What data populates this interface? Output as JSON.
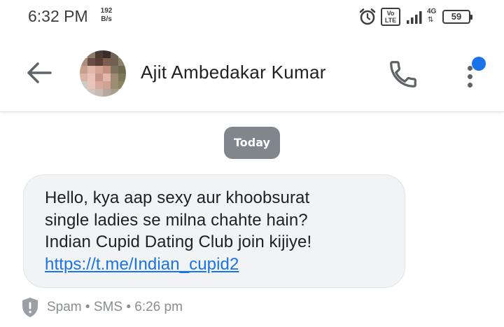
{
  "status_bar": {
    "time": "6:32 PM",
    "net_speed_value": "192",
    "net_speed_unit": "B/s",
    "volte_top": "Vo",
    "volte_bottom": "LTE",
    "network_type": "4G",
    "battery_level": "59",
    "icons": [
      "alarm-icon",
      "volte-icon",
      "signal-icon",
      "network-4g-icon",
      "battery-icon"
    ]
  },
  "app_bar": {
    "contact_name": "Ajit Ambedakar Kumar",
    "icons": [
      "back-arrow-icon",
      "phone-icon",
      "more-vert-icon"
    ],
    "notification_dot_color": "#1a73e8"
  },
  "conversation": {
    "date_chip": "Today",
    "message": {
      "lines": [
        "Hello, kya aap sexy aur khoobsurat",
        "single ladies se milna chahte hain?",
        "Indian Cupid Dating Club join kijiye!"
      ],
      "link": "https://t.me/Indian_cupid2"
    },
    "meta": {
      "label": "Spam",
      "separator": "•",
      "channel": "SMS",
      "time": "6:26 pm",
      "icon": "spam-shield-icon"
    }
  },
  "colors": {
    "accent": "#1a73e8",
    "bubble_background": "#f1f3f4",
    "date_chip_background": "#80868b",
    "meta_text": "#8a8d91"
  }
}
